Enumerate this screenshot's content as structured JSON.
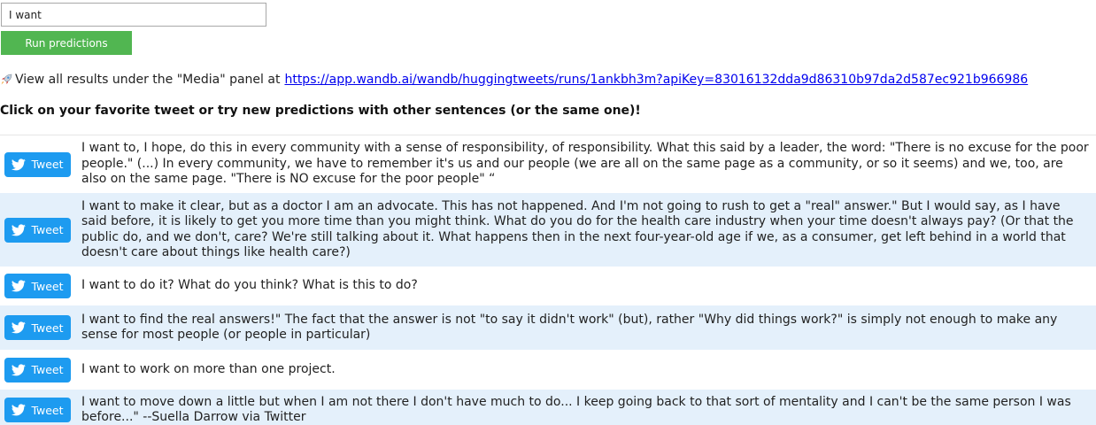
{
  "input": {
    "value": "I want",
    "placeholder": ""
  },
  "run_button": {
    "label": "Run predictions"
  },
  "results": {
    "text": "View all results under the \"Media\" panel at",
    "link": "https://app.wandb.ai/wandb/huggingtweets/runs/1ankbh3m?apiKey=83016132dda9d86310b97da2d587ec921b966986"
  },
  "instruction": "Click on your favorite tweet or try new predictions with other sentences (or the same one)!",
  "tweet_button_label": "Tweet",
  "tweets": [
    {
      "text": "I want to, I hope, do this in every community with a sense of responsibility, of responsibility. What this said by a leader, the word: \"There is no excuse for the poor people.\" (...) In every community, we have to remember it's us and our people (we are all on the same page as a community, or so it seems) and we, too, are also on the same page. \"There is NO excuse for the poor people\" “"
    },
    {
      "text": "I want to make it clear, but as a doctor I am an advocate. This has not happened. And I'm not going to rush to get a \"real\" answer.\" But I would say, as I have said before, it is likely to get you more time than you might think. What do you do for the health care industry when your time doesn't always pay? (Or that the public do, and we don't, care? We're still talking about it. What happens then in the next four-year-old age if we, as a consumer, get left behind in a world that doesn't care about things like health care?)"
    },
    {
      "text": "I want to do it? What do you think? What is this to do?"
    },
    {
      "text": "I want to find the real answers!\" The fact that the answer is not \"to say it didn't work\" (but), rather \"Why did things work?\" is simply not enough to make any sense for most people (or people in particular)"
    },
    {
      "text": "I want to work on more than one project."
    },
    {
      "text": "I want to move down a little but when I am not there I don't have much to do... I keep going back to that sort of mentality and I can't be the same person I was before...\" --Suella Darrow via Twitter"
    }
  ],
  "colors": {
    "run_button": "#51b651",
    "tweet_button": "#1d9bf0",
    "row_shade": "#e4f0fb",
    "link": "#0000ee"
  },
  "icons": {
    "results": "rocket-icon",
    "tweet": "twitter-bird-icon"
  }
}
